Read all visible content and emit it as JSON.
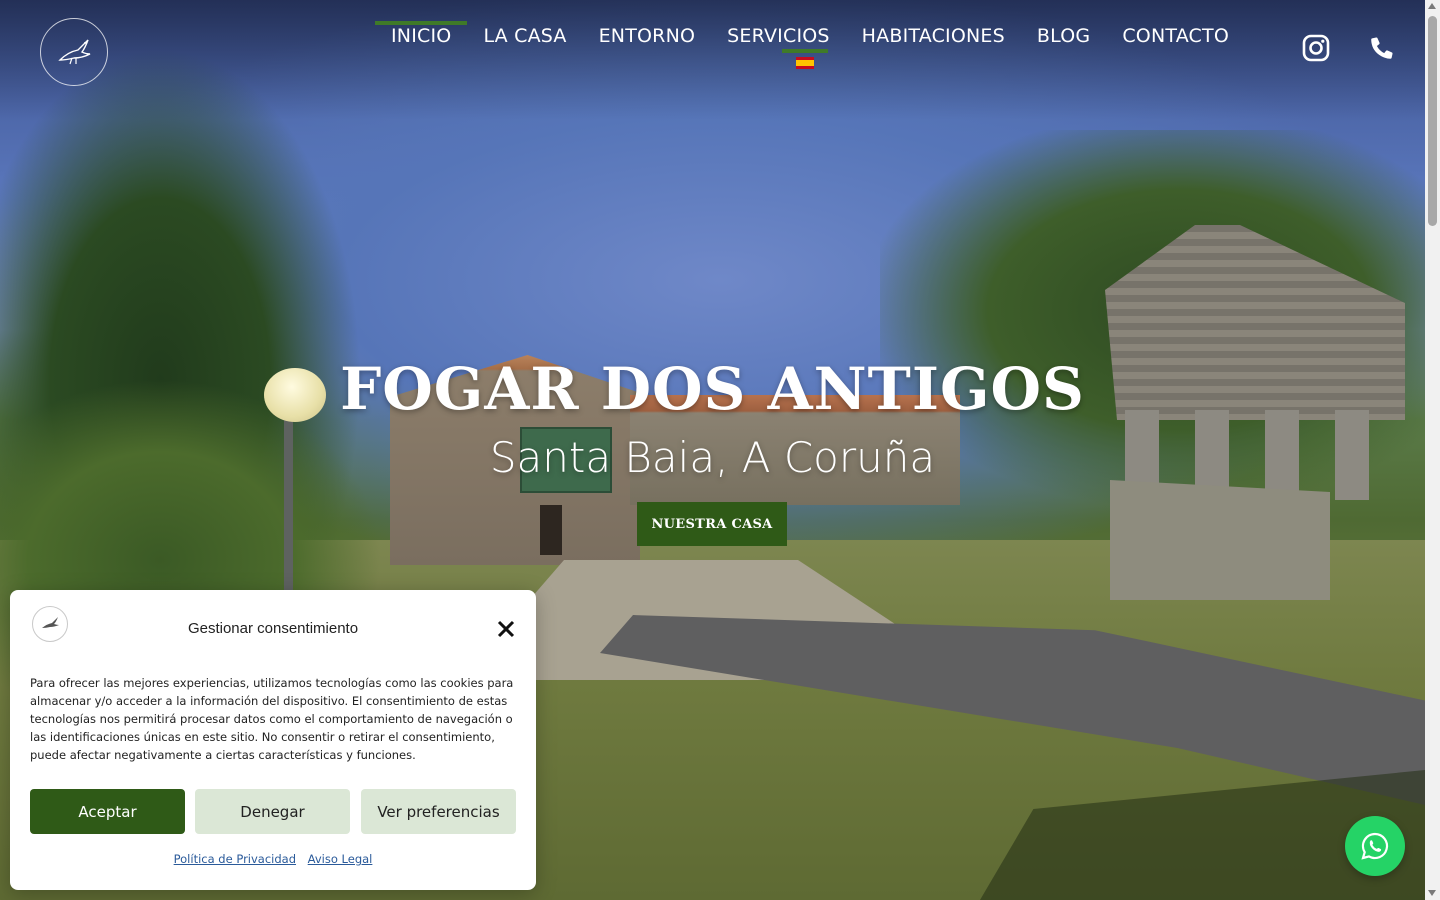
{
  "header": {
    "logo_text": "FOGAR DOS ANTIGOS",
    "nav": [
      {
        "label": "INICIO",
        "active": true
      },
      {
        "label": "LA CASA"
      },
      {
        "label": "ENTORNO"
      },
      {
        "label": "SERVICIOS"
      },
      {
        "label": "HABITACIONES"
      },
      {
        "label": "BLOG"
      },
      {
        "label": "CONTACTO"
      }
    ],
    "language_flag": "es-flag-icon",
    "social": [
      "instagram-icon",
      "phone-icon"
    ]
  },
  "hero": {
    "title": "FOGAR DOS ANTIGOS",
    "subtitle": "Santa Baia, A Coruña",
    "cta_label": "NUESTRA CASA"
  },
  "consent": {
    "title": "Gestionar consentimiento",
    "body": "Para ofrecer las mejores experiencias, utilizamos tecnologías como las cookies para almacenar y/o acceder a la información del dispositivo. El consentimiento de estas tecnologías nos permitirá procesar datos como el comportamiento de navegación o las identificaciones únicas en este sitio. No consentir o retirar el consentimiento, puede afectar negativamente a ciertas características y funciones.",
    "accept_label": "Aceptar",
    "deny_label": "Denegar",
    "prefs_label": "Ver preferencias",
    "privacy_link": "Política de Privacidad",
    "legal_link": "Aviso Legal"
  },
  "colors": {
    "accent": "#3f7a28",
    "button_dark_green": "#2f5a17",
    "button_light_green": "#dbe7d6",
    "whatsapp": "#25d366"
  }
}
